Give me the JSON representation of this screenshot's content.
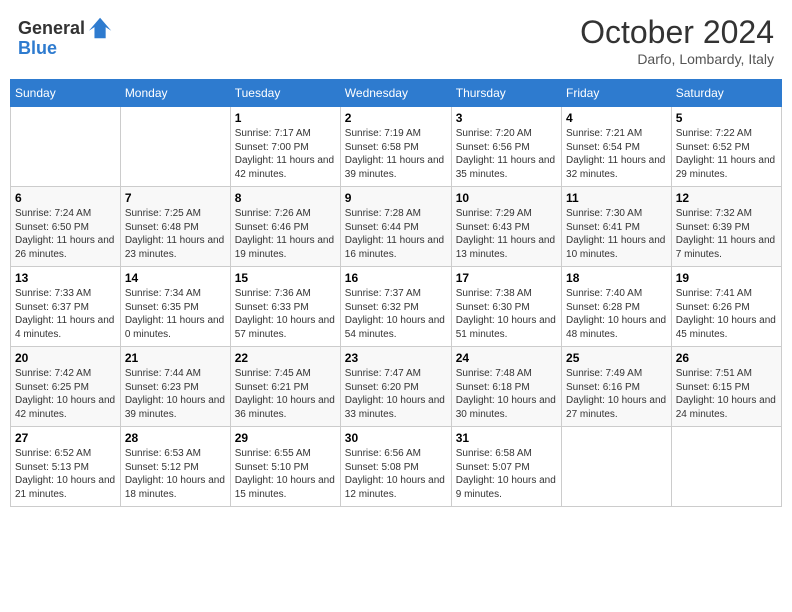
{
  "header": {
    "logo": {
      "line1": "General",
      "line2": "Blue"
    },
    "title": "October 2024",
    "location": "Darfo, Lombardy, Italy"
  },
  "weekdays": [
    "Sunday",
    "Monday",
    "Tuesday",
    "Wednesday",
    "Thursday",
    "Friday",
    "Saturday"
  ],
  "weeks": [
    [
      null,
      null,
      {
        "day": 1,
        "sunrise": "7:17 AM",
        "sunset": "7:00 PM",
        "daylight": "11 hours and 42 minutes."
      },
      {
        "day": 2,
        "sunrise": "7:19 AM",
        "sunset": "6:58 PM",
        "daylight": "11 hours and 39 minutes."
      },
      {
        "day": 3,
        "sunrise": "7:20 AM",
        "sunset": "6:56 PM",
        "daylight": "11 hours and 35 minutes."
      },
      {
        "day": 4,
        "sunrise": "7:21 AM",
        "sunset": "6:54 PM",
        "daylight": "11 hours and 32 minutes."
      },
      {
        "day": 5,
        "sunrise": "7:22 AM",
        "sunset": "6:52 PM",
        "daylight": "11 hours and 29 minutes."
      }
    ],
    [
      {
        "day": 6,
        "sunrise": "7:24 AM",
        "sunset": "6:50 PM",
        "daylight": "11 hours and 26 minutes."
      },
      {
        "day": 7,
        "sunrise": "7:25 AM",
        "sunset": "6:48 PM",
        "daylight": "11 hours and 23 minutes."
      },
      {
        "day": 8,
        "sunrise": "7:26 AM",
        "sunset": "6:46 PM",
        "daylight": "11 hours and 19 minutes."
      },
      {
        "day": 9,
        "sunrise": "7:28 AM",
        "sunset": "6:44 PM",
        "daylight": "11 hours and 16 minutes."
      },
      {
        "day": 10,
        "sunrise": "7:29 AM",
        "sunset": "6:43 PM",
        "daylight": "11 hours and 13 minutes."
      },
      {
        "day": 11,
        "sunrise": "7:30 AM",
        "sunset": "6:41 PM",
        "daylight": "11 hours and 10 minutes."
      },
      {
        "day": 12,
        "sunrise": "7:32 AM",
        "sunset": "6:39 PM",
        "daylight": "11 hours and 7 minutes."
      }
    ],
    [
      {
        "day": 13,
        "sunrise": "7:33 AM",
        "sunset": "6:37 PM",
        "daylight": "11 hours and 4 minutes."
      },
      {
        "day": 14,
        "sunrise": "7:34 AM",
        "sunset": "6:35 PM",
        "daylight": "11 hours and 0 minutes."
      },
      {
        "day": 15,
        "sunrise": "7:36 AM",
        "sunset": "6:33 PM",
        "daylight": "10 hours and 57 minutes."
      },
      {
        "day": 16,
        "sunrise": "7:37 AM",
        "sunset": "6:32 PM",
        "daylight": "10 hours and 54 minutes."
      },
      {
        "day": 17,
        "sunrise": "7:38 AM",
        "sunset": "6:30 PM",
        "daylight": "10 hours and 51 minutes."
      },
      {
        "day": 18,
        "sunrise": "7:40 AM",
        "sunset": "6:28 PM",
        "daylight": "10 hours and 48 minutes."
      },
      {
        "day": 19,
        "sunrise": "7:41 AM",
        "sunset": "6:26 PM",
        "daylight": "10 hours and 45 minutes."
      }
    ],
    [
      {
        "day": 20,
        "sunrise": "7:42 AM",
        "sunset": "6:25 PM",
        "daylight": "10 hours and 42 minutes."
      },
      {
        "day": 21,
        "sunrise": "7:44 AM",
        "sunset": "6:23 PM",
        "daylight": "10 hours and 39 minutes."
      },
      {
        "day": 22,
        "sunrise": "7:45 AM",
        "sunset": "6:21 PM",
        "daylight": "10 hours and 36 minutes."
      },
      {
        "day": 23,
        "sunrise": "7:47 AM",
        "sunset": "6:20 PM",
        "daylight": "10 hours and 33 minutes."
      },
      {
        "day": 24,
        "sunrise": "7:48 AM",
        "sunset": "6:18 PM",
        "daylight": "10 hours and 30 minutes."
      },
      {
        "day": 25,
        "sunrise": "7:49 AM",
        "sunset": "6:16 PM",
        "daylight": "10 hours and 27 minutes."
      },
      {
        "day": 26,
        "sunrise": "7:51 AM",
        "sunset": "6:15 PM",
        "daylight": "10 hours and 24 minutes."
      }
    ],
    [
      {
        "day": 27,
        "sunrise": "6:52 AM",
        "sunset": "5:13 PM",
        "daylight": "10 hours and 21 minutes."
      },
      {
        "day": 28,
        "sunrise": "6:53 AM",
        "sunset": "5:12 PM",
        "daylight": "10 hours and 18 minutes."
      },
      {
        "day": 29,
        "sunrise": "6:55 AM",
        "sunset": "5:10 PM",
        "daylight": "10 hours and 15 minutes."
      },
      {
        "day": 30,
        "sunrise": "6:56 AM",
        "sunset": "5:08 PM",
        "daylight": "10 hours and 12 minutes."
      },
      {
        "day": 31,
        "sunrise": "6:58 AM",
        "sunset": "5:07 PM",
        "daylight": "10 hours and 9 minutes."
      },
      null,
      null
    ]
  ]
}
